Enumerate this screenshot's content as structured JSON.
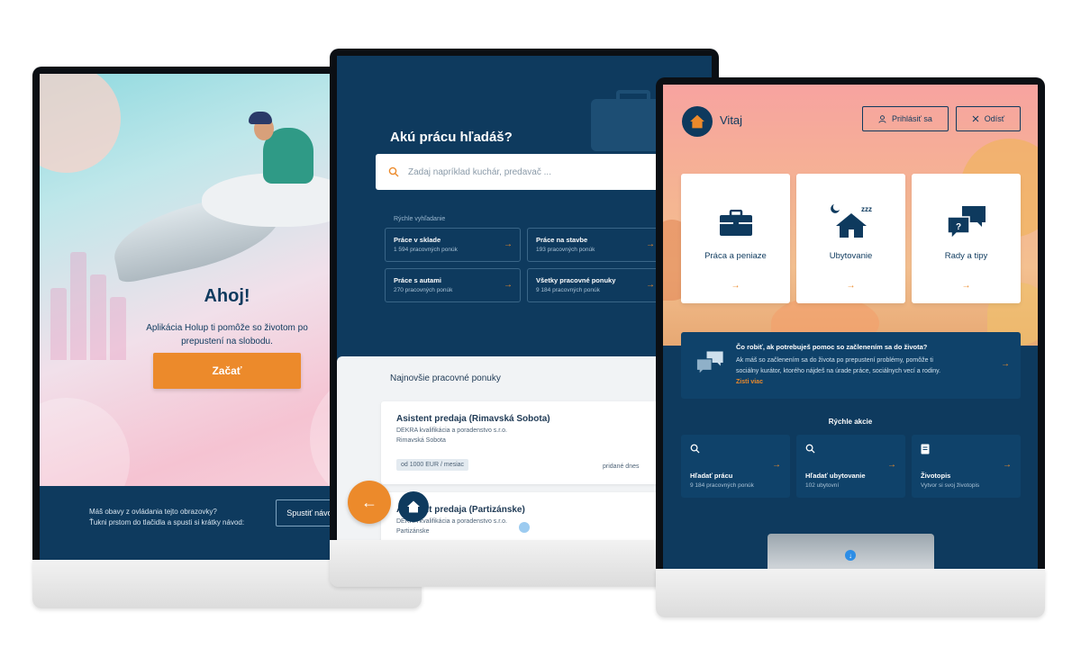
{
  "welcome": {
    "title": "Ahoj!",
    "text": "Aplikácia Holup ti pomôže so životom po prepustení na slobodu.",
    "start_label": "Začať",
    "help_line1": "Máš obavy z ovládania tejto obrazovky?",
    "help_line2": "Ťukni prstom do tlačidla a spusti si krátky návod:",
    "tutorial_label": "Spustiť návod"
  },
  "job_search": {
    "title": "Akú prácu hľadáš?",
    "search_placeholder": "Zadaj napríklad kuchár, predavač ...",
    "quick_label": "Rýchle vyhľadanie",
    "quick_items": [
      {
        "title": "Práce v sklade",
        "count": "1 594 pracovných ponúk"
      },
      {
        "title": "Práce na stavbe",
        "count": "193 pracovných ponúk"
      },
      {
        "title": "Práce s autami",
        "count": "270 pracovných ponúk"
      },
      {
        "title": "Všetky pracovné ponuky",
        "count": "9 184 pracovných ponúk"
      }
    ],
    "latest_title": "Najnovšie pracovné ponuky",
    "jobs": [
      {
        "title": "Asistent predaja (Rimavská Sobota)",
        "company": "DEKRA kvalifikácia a poradenstvo s.r.o.",
        "location": "Rimavská Sobota",
        "salary": "od 1000 EUR / mesiac",
        "date": "pridané dnes"
      },
      {
        "title": "Asistent predaja (Partizánske)",
        "company": "DEKRA kvalifikácia a poradenstvo s.r.o.",
        "location": "Partizánske"
      }
    ]
  },
  "home": {
    "greeting": "Vitaj",
    "login_label": "Prihlásiť sa",
    "logout_label": "Odísť",
    "categories": [
      {
        "label": "Práca a peniaze",
        "icon": "briefcase-icon"
      },
      {
        "label": "Ubytovanie",
        "icon": "house-icon"
      },
      {
        "label": "Rady a tipy",
        "icon": "chat-bubbles-icon"
      }
    ],
    "banner": {
      "title": "Čo robiť, ak potrebuješ pomoc so začlenením sa do života?",
      "body": "Ak máš so začlenením sa do života po prepustení problémy, pomôže ti sociálny kurátor, ktorého nájdeš na úrade práce, sociálnych vecí a rodiny.",
      "more_label": "Zisti viac"
    },
    "quick_title": "Rýchle akcie",
    "quick_actions": [
      {
        "label": "Hľadať prácu",
        "sub": "9 184 pracovných ponúk",
        "icon": "search-icon"
      },
      {
        "label": "Hľadať ubytovanie",
        "sub": "102 ubytovní",
        "icon": "search-icon"
      },
      {
        "label": "Životopis",
        "sub": "Vytvor si svoj životopis",
        "icon": "document-icon"
      }
    ]
  },
  "colors": {
    "navy": "#0e3a5e",
    "accent": "#ec8a2b",
    "panel": "#0f426a"
  }
}
